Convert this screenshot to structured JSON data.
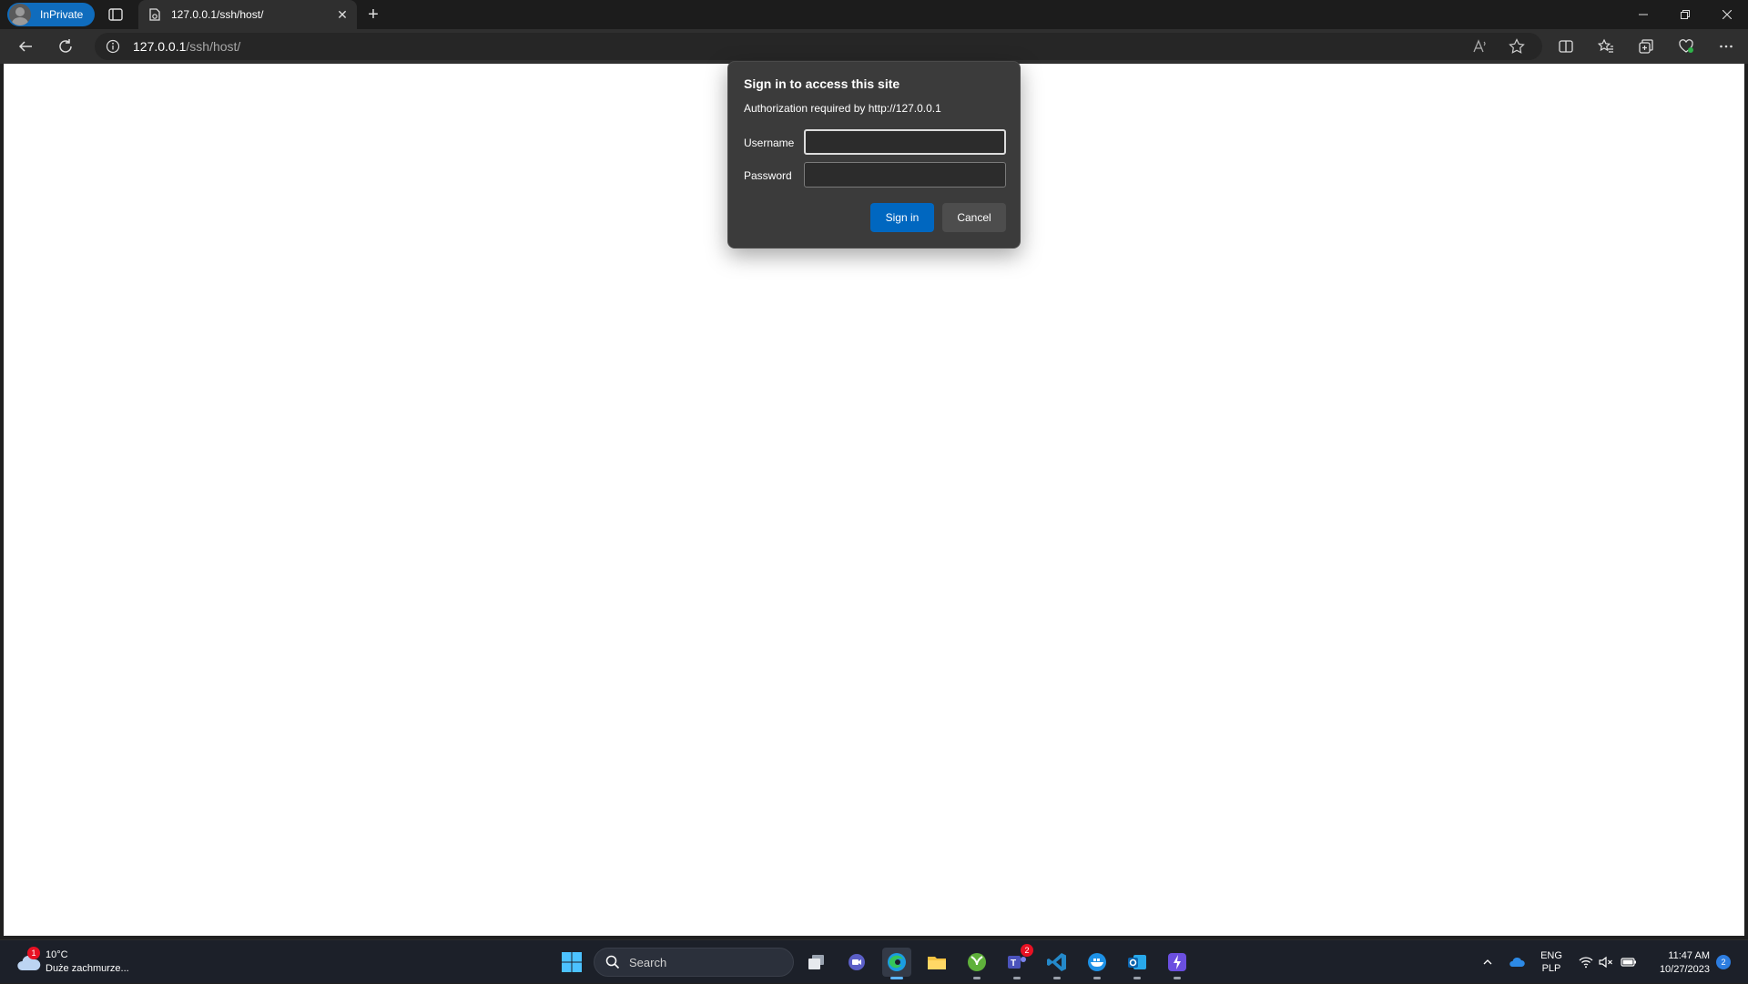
{
  "browser": {
    "profile_label": "InPrivate",
    "tab_title": "127.0.0.1/ssh/host/",
    "address": {
      "host": "127.0.0.1",
      "path": "/ssh/host/"
    }
  },
  "dialog": {
    "title": "Sign in to access this site",
    "subtitle": "Authorization required by http://127.0.0.1",
    "username_label": "Username",
    "username_value": "",
    "password_label": "Password",
    "password_value": "",
    "signin_label": "Sign in",
    "cancel_label": "Cancel"
  },
  "taskbar": {
    "weather_temp": "10°C",
    "weather_desc": "Duże zachmurze...",
    "weather_badge": "1",
    "search_label": "Search",
    "teams_badge": "2",
    "lang_top": "ENG",
    "lang_bottom": "PLP",
    "time": "11:47 AM",
    "date": "10/27/2023",
    "notifications": "2"
  },
  "colors": {
    "accent": "#0067c0",
    "inprivate": "#0f6cbd",
    "dialog_bg": "#3b3b3b",
    "page_bg": "#ffffff"
  }
}
